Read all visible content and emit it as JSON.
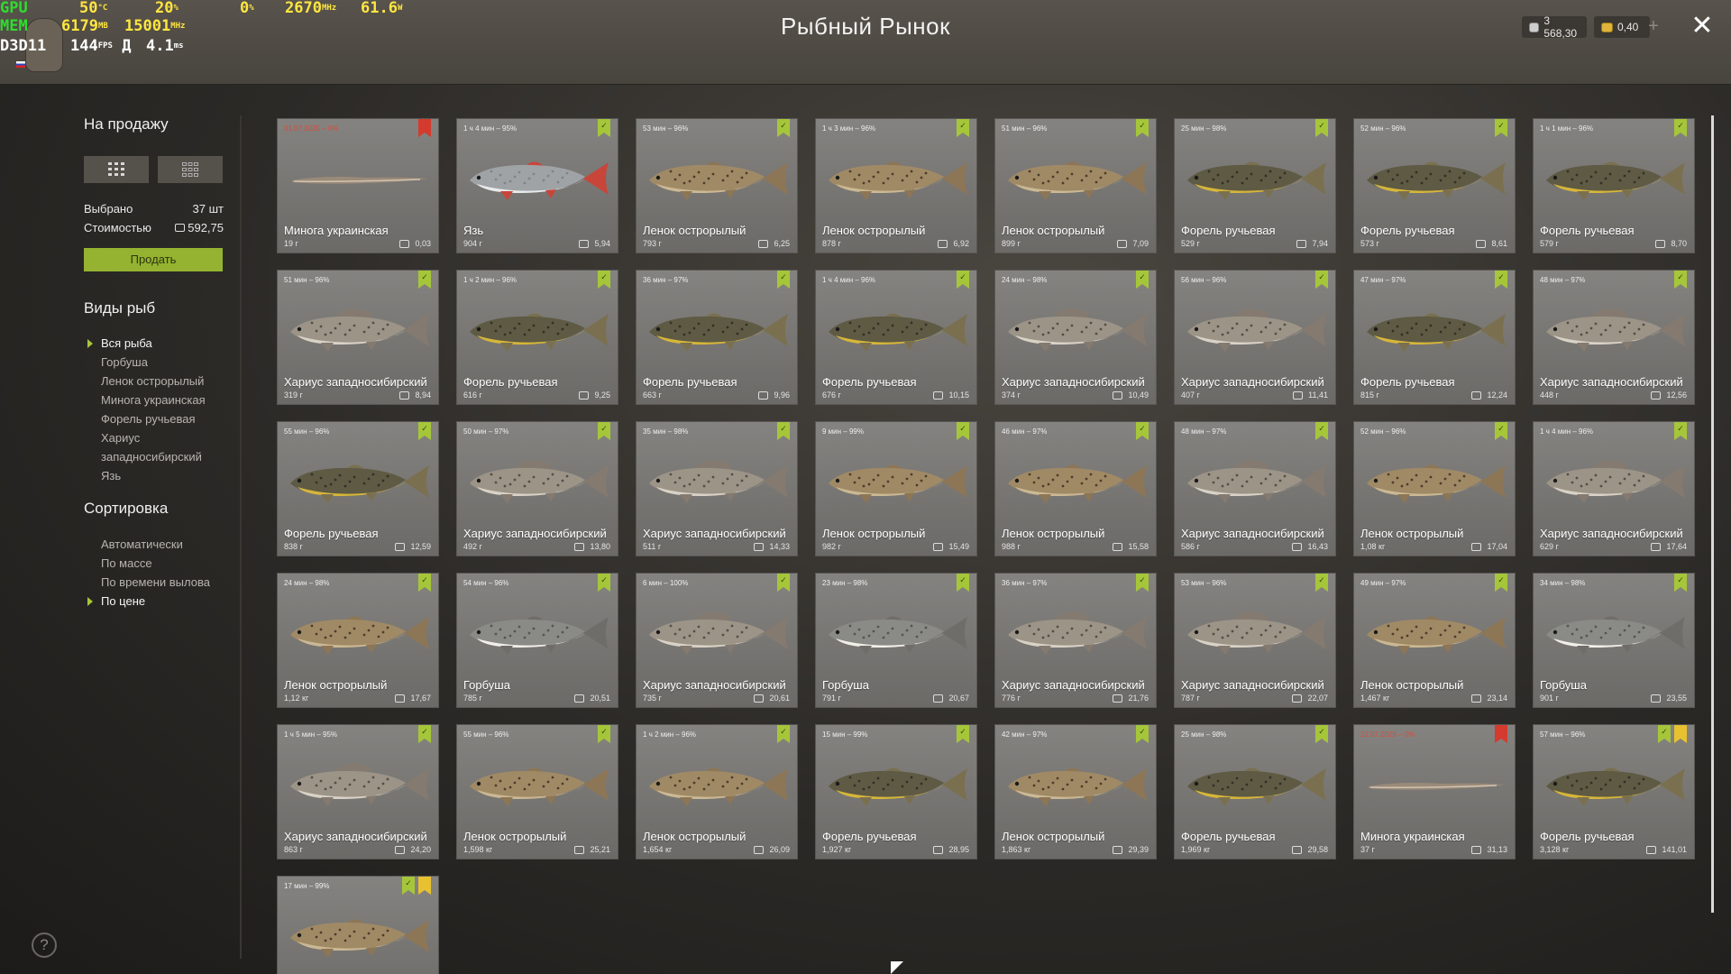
{
  "header": {
    "title": "Рыбный Рынок",
    "silver_balance": "3 568,30",
    "gold_balance": "0,40",
    "plus_label": "+",
    "close_label": "✕"
  },
  "overlay": {
    "gpu_label": "GPU",
    "gpu_temp": "50",
    "gpu_temp_unit": "°C",
    "gpu_load": "20",
    "gpu_load_unit": "%",
    "cpu_load": "0",
    "cpu_load_unit": "%",
    "gpu_clock": "2670",
    "gpu_clock_unit": "MHz",
    "fps_extra": "61.6",
    "fps_extra_unit": "W",
    "mem_label": "MEM",
    "mem_used": "6179",
    "mem_unit": "MB",
    "mem_clock": "15001",
    "mem_clock_unit": "MHz",
    "api_label": "D3D11",
    "fps": "144",
    "fps_unit": "FPS",
    "frametime": "4.1",
    "frametime_unit": "ms",
    "fps_suffix": "Д"
  },
  "sidebar": {
    "for_sale_title": "На продажу",
    "selected_label": "Выбрано",
    "selected_value": "37 шт",
    "cost_label": "Стоимостью",
    "cost_value": "592,75",
    "sell_button": "Продать",
    "species_title": "Виды рыб",
    "species": [
      {
        "label": "Вся рыба",
        "active": true
      },
      {
        "label": "Горбуша",
        "active": false
      },
      {
        "label": "Ленок острорылый",
        "active": false
      },
      {
        "label": "Минога украинская",
        "active": false
      },
      {
        "label": "Форель ручьевая",
        "active": false
      },
      {
        "label": "Хариус западносибирский",
        "active": false
      },
      {
        "label": "Язь",
        "active": false
      }
    ],
    "sort_title": "Сортировка",
    "sort_options": [
      {
        "label": "Автоматически",
        "active": false
      },
      {
        "label": "По массе",
        "active": false
      },
      {
        "label": "По времени вылова",
        "active": false
      },
      {
        "label": "По цене",
        "active": true
      }
    ],
    "help_label": "?"
  },
  "fish_cards": [
    {
      "top": "31.07.2025 – 0%",
      "red": true,
      "name": "Минога украинская",
      "weight": "19 г",
      "price": "0,03",
      "marks": [
        "red"
      ],
      "kind": "lamprey"
    },
    {
      "top": "1 ч 4 мин – 95%",
      "red": false,
      "name": "Язь",
      "weight": "904 г",
      "price": "5,94",
      "marks": [
        "green"
      ],
      "kind": "ide"
    },
    {
      "top": "53 мин – 96%",
      "red": false,
      "name": "Ленок острорылый",
      "weight": "793 г",
      "price": "6,25",
      "marks": [
        "green"
      ],
      "kind": "lenok"
    },
    {
      "top": "1 ч 3 мин – 96%",
      "red": false,
      "name": "Ленок острорылый",
      "weight": "878 г",
      "price": "6,92",
      "marks": [
        "green"
      ],
      "kind": "lenok"
    },
    {
      "top": "51 мин – 96%",
      "red": false,
      "name": "Ленок острорылый",
      "weight": "899 г",
      "price": "7,09",
      "marks": [
        "green"
      ],
      "kind": "lenok"
    },
    {
      "top": "25 мин – 98%",
      "red": false,
      "name": "Форель ручьевая",
      "weight": "529 г",
      "price": "7,94",
      "marks": [
        "green"
      ],
      "kind": "trout"
    },
    {
      "top": "52 мин – 96%",
      "red": false,
      "name": "Форель ручьевая",
      "weight": "573 г",
      "price": "8,61",
      "marks": [
        "green"
      ],
      "kind": "trout"
    },
    {
      "top": "1 ч 1 мин – 96%",
      "red": false,
      "name": "Форель ручьевая",
      "weight": "579 г",
      "price": "8,70",
      "marks": [
        "green"
      ],
      "kind": "trout"
    },
    {
      "top": "51 мин – 96%",
      "red": false,
      "name": "Хариус западносибирский",
      "weight": "319 г",
      "price": "8,94",
      "marks": [
        "green"
      ],
      "kind": "grayling"
    },
    {
      "top": "1 ч 2 мин – 96%",
      "red": false,
      "name": "Форель ручьевая",
      "weight": "616 г",
      "price": "9,25",
      "marks": [
        "green"
      ],
      "kind": "trout"
    },
    {
      "top": "36 мин – 97%",
      "red": false,
      "name": "Форель ручьевая",
      "weight": "663 г",
      "price": "9,96",
      "marks": [
        "green"
      ],
      "kind": "trout"
    },
    {
      "top": "1 ч 4 мин – 96%",
      "red": false,
      "name": "Форель ручьевая",
      "weight": "676 г",
      "price": "10,15",
      "marks": [
        "green"
      ],
      "kind": "trout"
    },
    {
      "top": "24 мин – 98%",
      "red": false,
      "name": "Хариус западносибирский",
      "weight": "374 г",
      "price": "10,49",
      "marks": [
        "green"
      ],
      "kind": "grayling"
    },
    {
      "top": "56 мин – 96%",
      "red": false,
      "name": "Хариус западносибирский",
      "weight": "407 г",
      "price": "11,41",
      "marks": [
        "green"
      ],
      "kind": "grayling"
    },
    {
      "top": "47 мин – 97%",
      "red": false,
      "name": "Форель ручьевая",
      "weight": "815 г",
      "price": "12,24",
      "marks": [
        "green"
      ],
      "kind": "trout"
    },
    {
      "top": "48 мин – 97%",
      "red": false,
      "name": "Хариус западносибирский",
      "weight": "448 г",
      "price": "12,56",
      "marks": [
        "green"
      ],
      "kind": "grayling"
    },
    {
      "top": "55 мин – 96%",
      "red": false,
      "name": "Форель ручьевая",
      "weight": "838 г",
      "price": "12,59",
      "marks": [
        "green"
      ],
      "kind": "trout"
    },
    {
      "top": "50 мин – 97%",
      "red": false,
      "name": "Хариус западносибирский",
      "weight": "492 г",
      "price": "13,80",
      "marks": [
        "green"
      ],
      "kind": "grayling"
    },
    {
      "top": "35 мин – 98%",
      "red": false,
      "name": "Хариус западносибирский",
      "weight": "511 г",
      "price": "14,33",
      "marks": [
        "green"
      ],
      "kind": "grayling"
    },
    {
      "top": "9 мин – 99%",
      "red": false,
      "name": "Ленок острорылый",
      "weight": "982 г",
      "price": "15,49",
      "marks": [
        "green"
      ],
      "kind": "lenok"
    },
    {
      "top": "46 мин – 97%",
      "red": false,
      "name": "Ленок острорылый",
      "weight": "988 г",
      "price": "15,58",
      "marks": [
        "green"
      ],
      "kind": "lenok"
    },
    {
      "top": "48 мин – 97%",
      "red": false,
      "name": "Хариус западносибирский",
      "weight": "586 г",
      "price": "16,43",
      "marks": [
        "green"
      ],
      "kind": "grayling"
    },
    {
      "top": "52 мин – 96%",
      "red": false,
      "name": "Ленок острорылый",
      "weight": "1,08 кг",
      "price": "17,04",
      "marks": [
        "green"
      ],
      "kind": "lenok"
    },
    {
      "top": "1 ч 4 мин – 96%",
      "red": false,
      "name": "Хариус западносибирский",
      "weight": "629 г",
      "price": "17,64",
      "marks": [
        "green"
      ],
      "kind": "grayling"
    },
    {
      "top": "24 мин – 98%",
      "red": false,
      "name": "Ленок острорылый",
      "weight": "1,12 кг",
      "price": "17,67",
      "marks": [
        "green"
      ],
      "kind": "lenok"
    },
    {
      "top": "54 мин – 96%",
      "red": false,
      "name": "Горбуша",
      "weight": "785 г",
      "price": "20,51",
      "marks": [
        "green"
      ],
      "kind": "salmon"
    },
    {
      "top": "6 мин – 100%",
      "red": false,
      "name": "Хариус западносибирский",
      "weight": "735 г",
      "price": "20,61",
      "marks": [
        "green"
      ],
      "kind": "grayling"
    },
    {
      "top": "23 мин – 98%",
      "red": false,
      "name": "Горбуша",
      "weight": "791 г",
      "price": "20,67",
      "marks": [
        "green"
      ],
      "kind": "salmon"
    },
    {
      "top": "36 мин – 97%",
      "red": false,
      "name": "Хариус западносибирский",
      "weight": "776 г",
      "price": "21,76",
      "marks": [
        "green"
      ],
      "kind": "grayling"
    },
    {
      "top": "53 мин – 96%",
      "red": false,
      "name": "Хариус западносибирский",
      "weight": "787 г",
      "price": "22,07",
      "marks": [
        "green"
      ],
      "kind": "grayling"
    },
    {
      "top": "49 мин – 97%",
      "red": false,
      "name": "Ленок острорылый",
      "weight": "1,467 кг",
      "price": "23,14",
      "marks": [
        "green"
      ],
      "kind": "lenok"
    },
    {
      "top": "34 мин – 98%",
      "red": false,
      "name": "Горбуша",
      "weight": "901 г",
      "price": "23,55",
      "marks": [
        "green"
      ],
      "kind": "salmon"
    },
    {
      "top": "1 ч 5 мин – 95%",
      "red": false,
      "name": "Хариус западносибирский",
      "weight": "863 г",
      "price": "24,20",
      "marks": [
        "green"
      ],
      "kind": "grayling"
    },
    {
      "top": "55 мин – 96%",
      "red": false,
      "name": "Ленок острорылый",
      "weight": "1,598 кг",
      "price": "25,21",
      "marks": [
        "green"
      ],
      "kind": "lenok"
    },
    {
      "top": "1 ч 2 мин – 96%",
      "red": false,
      "name": "Ленок острорылый",
      "weight": "1,654 кг",
      "price": "26,09",
      "marks": [
        "green"
      ],
      "kind": "lenok"
    },
    {
      "top": "15 мин – 99%",
      "red": false,
      "name": "Форель ручьевая",
      "weight": "1,927 кг",
      "price": "28,95",
      "marks": [
        "green"
      ],
      "kind": "trout"
    },
    {
      "top": "42 мин – 97%",
      "red": false,
      "name": "Ленок острорылый",
      "weight": "1,863 кг",
      "price": "29,39",
      "marks": [
        "green"
      ],
      "kind": "lenok"
    },
    {
      "top": "25 мин – 98%",
      "red": false,
      "name": "Форель ручьевая",
      "weight": "1,969 кг",
      "price": "29,58",
      "marks": [
        "green"
      ],
      "kind": "trout"
    },
    {
      "top": "22.07.2025 – 0%",
      "red": true,
      "name": "Минога украинская",
      "weight": "37 г",
      "price": "31,13",
      "marks": [
        "red"
      ],
      "kind": "lamprey"
    },
    {
      "top": "57 мин – 96%",
      "red": false,
      "name": "Форель ручьевая",
      "weight": "3,128 кг",
      "price": "141,01",
      "marks": [
        "green",
        "yellow"
      ],
      "kind": "trout"
    },
    {
      "top": "17 мин – 99%",
      "red": false,
      "name": "",
      "weight": "",
      "price": "",
      "marks": [
        "green",
        "yellow"
      ],
      "kind": "lenok"
    }
  ],
  "colors": {
    "accent_green": "#a6c63a",
    "bookmark_red": "#d43a2e",
    "bookmark_yellow": "#e7c12f",
    "date_red": "#e04836",
    "sell_button": "#95b330"
  }
}
